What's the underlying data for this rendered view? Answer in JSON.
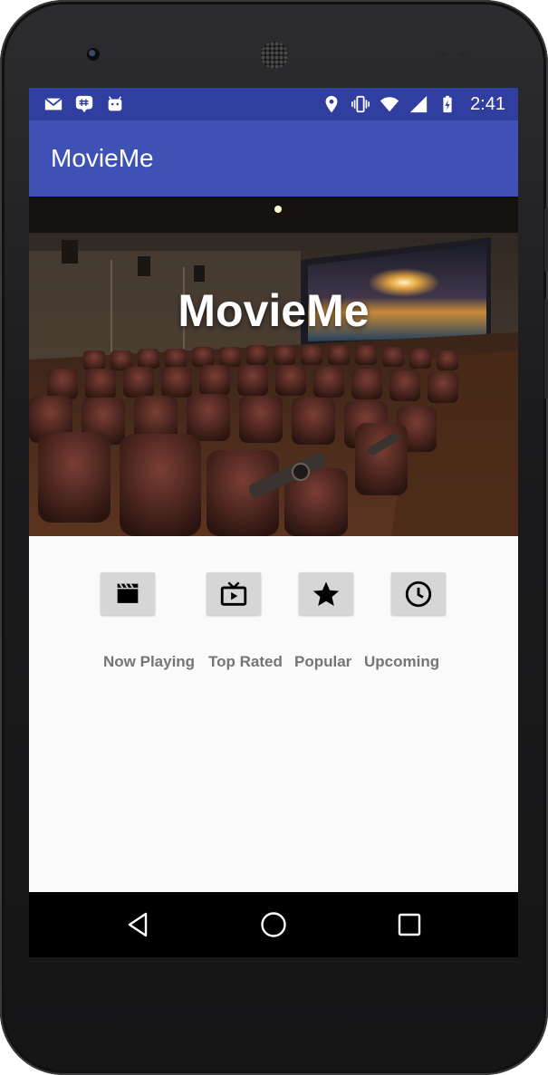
{
  "status_bar": {
    "time": "2:41",
    "left_icons": [
      "gmail-icon",
      "groupme-icon",
      "android-debug-icon"
    ],
    "right_icons": [
      "location-icon",
      "vibrate-icon",
      "wifi-icon",
      "signal-icon",
      "battery-charging-icon"
    ]
  },
  "app_bar": {
    "title": "MovieMe"
  },
  "hero": {
    "title": "MovieMe"
  },
  "categories": [
    {
      "label": "Now Playing",
      "icon": "clapperboard-icon"
    },
    {
      "label": "Top Rated",
      "icon": "tv-icon"
    },
    {
      "label": "Popular",
      "icon": "star-icon"
    },
    {
      "label": "Upcoming",
      "icon": "clock-icon"
    }
  ],
  "nav_bar": {
    "buttons": [
      "back-icon",
      "home-icon",
      "recents-icon"
    ]
  },
  "colors": {
    "status_bar": "#303f9f",
    "app_bar": "#3f51b5",
    "button_bg": "#d6d6d6",
    "label_text": "#757575"
  }
}
